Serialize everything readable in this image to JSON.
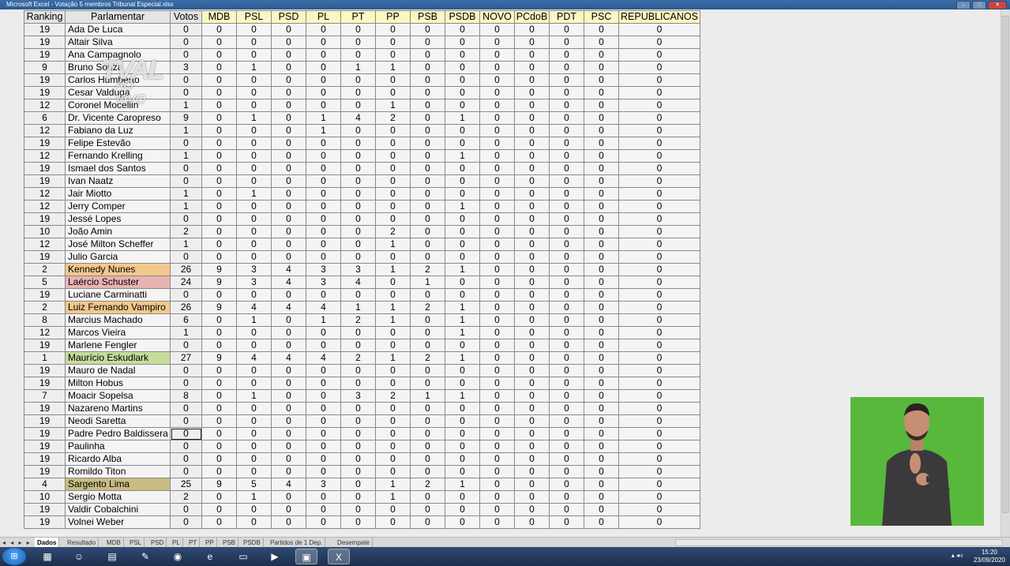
{
  "window": {
    "title": "Microsoft Excel - Votação 5 membros Tribunal Especial.xlsx",
    "minimize_icon": "minimize-icon",
    "maximize_icon": "maximize-icon",
    "close_icon": "close-icon"
  },
  "watermark": {
    "line1": "TVAL",
    "line2": "AO VIVO"
  },
  "table": {
    "headers": [
      "Ranking",
      "Parlamentar",
      "Votos",
      "MDB",
      "PSL",
      "PSD",
      "PL",
      "PT",
      "PP",
      "PSB",
      "PSDB",
      "NOVO",
      "PCdoB",
      "PDT",
      "PSC",
      "REPUBLICANOS"
    ],
    "rows": [
      [
        "19",
        "Ada De Luca",
        "0",
        "0",
        "0",
        "0",
        "0",
        "0",
        "0",
        "0",
        "0",
        "0",
        "0",
        "0",
        "0",
        "0"
      ],
      [
        "19",
        "Altair Silva",
        "0",
        "0",
        "0",
        "0",
        "0",
        "0",
        "0",
        "0",
        "0",
        "0",
        "0",
        "0",
        "0",
        "0"
      ],
      [
        "19",
        "Ana Campagnolo",
        "0",
        "0",
        "0",
        "0",
        "0",
        "0",
        "0",
        "0",
        "0",
        "0",
        "0",
        "0",
        "0",
        "0"
      ],
      [
        "9",
        "Bruno Souza",
        "3",
        "0",
        "1",
        "0",
        "0",
        "1",
        "1",
        "0",
        "0",
        "0",
        "0",
        "0",
        "0",
        "0"
      ],
      [
        "19",
        "Carlos Humberto",
        "0",
        "0",
        "0",
        "0",
        "0",
        "0",
        "0",
        "0",
        "0",
        "0",
        "0",
        "0",
        "0",
        "0"
      ],
      [
        "19",
        "Cesar Valduga",
        "0",
        "0",
        "0",
        "0",
        "0",
        "0",
        "0",
        "0",
        "0",
        "0",
        "0",
        "0",
        "0",
        "0"
      ],
      [
        "12",
        "Coronel Mocellin",
        "1",
        "0",
        "0",
        "0",
        "0",
        "0",
        "1",
        "0",
        "0",
        "0",
        "0",
        "0",
        "0",
        "0"
      ],
      [
        "6",
        "Dr. Vicente Caropreso",
        "9",
        "0",
        "1",
        "0",
        "1",
        "4",
        "2",
        "0",
        "1",
        "0",
        "0",
        "0",
        "0",
        "0"
      ],
      [
        "12",
        "Fabiano da Luz",
        "1",
        "0",
        "0",
        "0",
        "1",
        "0",
        "0",
        "0",
        "0",
        "0",
        "0",
        "0",
        "0",
        "0"
      ],
      [
        "19",
        "Felipe Estevão",
        "0",
        "0",
        "0",
        "0",
        "0",
        "0",
        "0",
        "0",
        "0",
        "0",
        "0",
        "0",
        "0",
        "0"
      ],
      [
        "12",
        "Fernando Krelling",
        "1",
        "0",
        "0",
        "0",
        "0",
        "0",
        "0",
        "0",
        "1",
        "0",
        "0",
        "0",
        "0",
        "0"
      ],
      [
        "19",
        "Ismael dos Santos",
        "0",
        "0",
        "0",
        "0",
        "0",
        "0",
        "0",
        "0",
        "0",
        "0",
        "0",
        "0",
        "0",
        "0"
      ],
      [
        "19",
        "Ivan Naatz",
        "0",
        "0",
        "0",
        "0",
        "0",
        "0",
        "0",
        "0",
        "0",
        "0",
        "0",
        "0",
        "0",
        "0"
      ],
      [
        "12",
        "Jair Miotto",
        "1",
        "0",
        "1",
        "0",
        "0",
        "0",
        "0",
        "0",
        "0",
        "0",
        "0",
        "0",
        "0",
        "0"
      ],
      [
        "12",
        "Jerry Comper",
        "1",
        "0",
        "0",
        "0",
        "0",
        "0",
        "0",
        "0",
        "1",
        "0",
        "0",
        "0",
        "0",
        "0"
      ],
      [
        "19",
        "Jessé Lopes",
        "0",
        "0",
        "0",
        "0",
        "0",
        "0",
        "0",
        "0",
        "0",
        "0",
        "0",
        "0",
        "0",
        "0"
      ],
      [
        "10",
        "João Amin",
        "2",
        "0",
        "0",
        "0",
        "0",
        "0",
        "2",
        "0",
        "0",
        "0",
        "0",
        "0",
        "0",
        "0"
      ],
      [
        "12",
        "José Milton Scheffer",
        "1",
        "0",
        "0",
        "0",
        "0",
        "0",
        "1",
        "0",
        "0",
        "0",
        "0",
        "0",
        "0",
        "0"
      ],
      [
        "19",
        "Julio Garcia",
        "0",
        "0",
        "0",
        "0",
        "0",
        "0",
        "0",
        "0",
        "0",
        "0",
        "0",
        "0",
        "0",
        "0"
      ],
      [
        "2",
        "Kennedy Nunes",
        "26",
        "9",
        "3",
        "4",
        "3",
        "3",
        "1",
        "2",
        "1",
        "0",
        "0",
        "0",
        "0",
        "0"
      ],
      [
        "5",
        "Laércio Schuster",
        "24",
        "9",
        "3",
        "4",
        "3",
        "4",
        "0",
        "1",
        "0",
        "0",
        "0",
        "0",
        "0",
        "0"
      ],
      [
        "19",
        "Luciane Carminatti",
        "0",
        "0",
        "0",
        "0",
        "0",
        "0",
        "0",
        "0",
        "0",
        "0",
        "0",
        "0",
        "0",
        "0"
      ],
      [
        "2",
        "Luiz Fernando Vampiro",
        "26",
        "9",
        "4",
        "4",
        "4",
        "1",
        "1",
        "2",
        "1",
        "0",
        "0",
        "0",
        "0",
        "0"
      ],
      [
        "8",
        "Marcius Machado",
        "6",
        "0",
        "1",
        "0",
        "1",
        "2",
        "1",
        "0",
        "1",
        "0",
        "0",
        "0",
        "0",
        "0"
      ],
      [
        "12",
        "Marcos Vieira",
        "1",
        "0",
        "0",
        "0",
        "0",
        "0",
        "0",
        "0",
        "1",
        "0",
        "0",
        "0",
        "0",
        "0"
      ],
      [
        "19",
        "Marlene Fengler",
        "0",
        "0",
        "0",
        "0",
        "0",
        "0",
        "0",
        "0",
        "0",
        "0",
        "0",
        "0",
        "0",
        "0"
      ],
      [
        "1",
        "Maurício Eskudlark",
        "27",
        "9",
        "4",
        "4",
        "4",
        "2",
        "1",
        "2",
        "1",
        "0",
        "0",
        "0",
        "0",
        "0"
      ],
      [
        "19",
        "Mauro de Nadal",
        "0",
        "0",
        "0",
        "0",
        "0",
        "0",
        "0",
        "0",
        "0",
        "0",
        "0",
        "0",
        "0",
        "0"
      ],
      [
        "19",
        "Milton Hobus",
        "0",
        "0",
        "0",
        "0",
        "0",
        "0",
        "0",
        "0",
        "0",
        "0",
        "0",
        "0",
        "0",
        "0"
      ],
      [
        "7",
        "Moacir Sopelsa",
        "8",
        "0",
        "1",
        "0",
        "0",
        "3",
        "2",
        "1",
        "1",
        "0",
        "0",
        "0",
        "0",
        "0"
      ],
      [
        "19",
        "Nazareno Martins",
        "0",
        "0",
        "0",
        "0",
        "0",
        "0",
        "0",
        "0",
        "0",
        "0",
        "0",
        "0",
        "0",
        "0"
      ],
      [
        "19",
        "Neodi Saretta",
        "0",
        "0",
        "0",
        "0",
        "0",
        "0",
        "0",
        "0",
        "0",
        "0",
        "0",
        "0",
        "0",
        "0"
      ],
      [
        "19",
        "Padre Pedro Baldissera",
        "0",
        "0",
        "0",
        "0",
        "0",
        "0",
        "0",
        "0",
        "0",
        "0",
        "0",
        "0",
        "0",
        "0"
      ],
      [
        "19",
        "Paulinha",
        "0",
        "0",
        "0",
        "0",
        "0",
        "0",
        "0",
        "0",
        "0",
        "0",
        "0",
        "0",
        "0",
        "0"
      ],
      [
        "19",
        "Ricardo Alba",
        "0",
        "0",
        "0",
        "0",
        "0",
        "0",
        "0",
        "0",
        "0",
        "0",
        "0",
        "0",
        "0",
        "0"
      ],
      [
        "19",
        "Romildo Titon",
        "0",
        "0",
        "0",
        "0",
        "0",
        "0",
        "0",
        "0",
        "0",
        "0",
        "0",
        "0",
        "0",
        "0"
      ],
      [
        "4",
        "Sargento Lima",
        "25",
        "9",
        "5",
        "4",
        "3",
        "0",
        "1",
        "2",
        "1",
        "0",
        "0",
        "0",
        "0",
        "0"
      ],
      [
        "10",
        "Sergio Motta",
        "2",
        "0",
        "1",
        "0",
        "0",
        "0",
        "1",
        "0",
        "0",
        "0",
        "0",
        "0",
        "0",
        "0"
      ],
      [
        "19",
        "Valdir Cobalchini",
        "0",
        "0",
        "0",
        "0",
        "0",
        "0",
        "0",
        "0",
        "0",
        "0",
        "0",
        "0",
        "0",
        "0"
      ],
      [
        "19",
        "Volnei Weber",
        "0",
        "0",
        "0",
        "0",
        "0",
        "0",
        "0",
        "0",
        "0",
        "0",
        "0",
        "0",
        "0",
        "0"
      ]
    ],
    "highlight_colors": {
      "Kennedy Nunes": "#f3c88c",
      "Laércio Schuster": "#e8b3b3",
      "Luiz Fernando Vampiro": "#f3c88c",
      "Maurício Eskudlark": "#c6dc9a",
      "Sargento Lima": "#c8bc82"
    },
    "header_color": "#fbf7c2"
  },
  "sheet_tabs": {
    "nav_arrows": "◂ ◂ ▸ ▸",
    "items": [
      "Dados",
      "Resultado",
      "MDB",
      "PSL",
      "PSD",
      "PL",
      "PT",
      "PP",
      "PSB",
      "PSDB",
      "Partidos de 1 Dep.",
      "Desempate"
    ],
    "active": "Dados"
  },
  "taskbar": {
    "icons": [
      "start-icon",
      "calendar-icon",
      "people-icon",
      "document-icon",
      "notepad-icon",
      "chrome-icon",
      "ie-icon",
      "folder-icon",
      "zoom-icon",
      "files-icon",
      "excel-icon"
    ],
    "time": "15:20",
    "date": "23/09/2020"
  }
}
